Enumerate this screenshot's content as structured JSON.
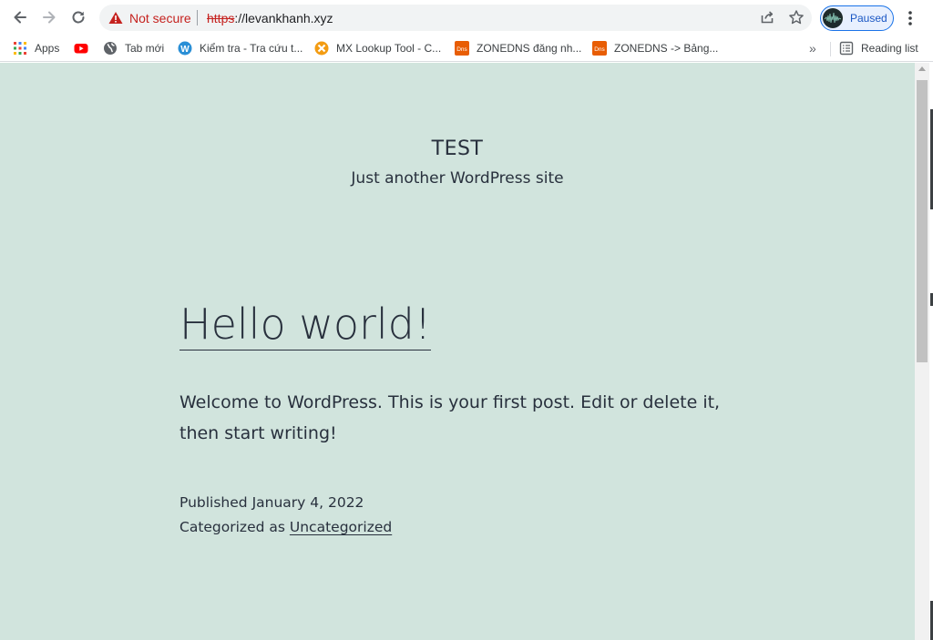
{
  "toolbar": {
    "not_secure": "Not secure",
    "url_scheme": "https",
    "url_rest": "://levankhanh.xyz",
    "profile_label": "Paused"
  },
  "bookmarks": [
    {
      "label": "Apps",
      "icon": "apps-grid-icon"
    },
    {
      "label": "",
      "icon": "youtube-icon"
    },
    {
      "label": "Tab mới",
      "icon": "globe-icon"
    },
    {
      "label": "Kiểm tra - Tra cứu t...",
      "icon": "w-logo-icon"
    },
    {
      "label": "MX Lookup Tool - C...",
      "icon": "mxtoolbox-icon"
    },
    {
      "label": "ZONEDNS đăng nh...",
      "icon": "dns-icon"
    },
    {
      "label": "ZONEDNS -> Bảng...",
      "icon": "dns-icon"
    }
  ],
  "bookmarks_more": "»",
  "reading_list": "Reading list",
  "site": {
    "title": "TEST",
    "description": "Just another WordPress site"
  },
  "post": {
    "title": "Hello world!",
    "body": "Welcome to WordPress. This is your first post. Edit or delete it, then start writing!",
    "published_label": "Published",
    "published_date": "January 4, 2022",
    "categorized_label": "Categorized as",
    "category": "Uncategorized"
  },
  "colors": {
    "page_background": "#d1e4dd",
    "text": "#28303d",
    "warning": "#c5221f",
    "accent": "#1a73e8"
  }
}
